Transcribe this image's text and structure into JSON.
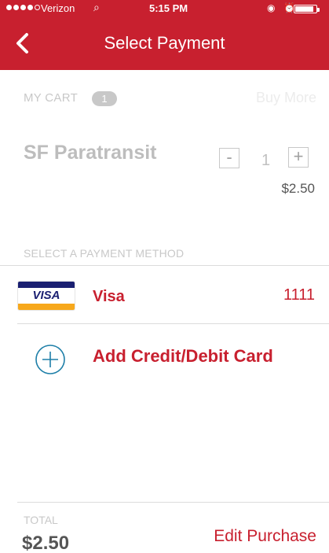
{
  "status_bar": {
    "carrier": "Verizon",
    "time": "5:15 PM",
    "signal_bars_filled": 4,
    "signal_bars_total": 5,
    "battery_level": 0.9
  },
  "header": {
    "title": "Select Payment",
    "back_icon": "chevron-left-icon",
    "background_color": "#c8202f"
  },
  "cart": {
    "label": "MY CART",
    "count": "1",
    "buy_more": "Buy More",
    "item": {
      "name": "SF Paratransit",
      "quantity": "1",
      "decrement_label": "-",
      "increment_label": "+",
      "price": "$2.50"
    }
  },
  "payment": {
    "section_label": "SELECT A PAYMENT METHOD",
    "methods": [
      {
        "brand_text": "VISA",
        "label": "Visa",
        "last4": "1111"
      }
    ],
    "add_card_label": "Add Credit/Debit Card",
    "add_icon": "plus-circle-icon",
    "accent_color": "#c8202f"
  },
  "footer": {
    "total_label": "TOTAL",
    "total_value": "$2.50",
    "edit_purchase": "Edit Purchase"
  }
}
